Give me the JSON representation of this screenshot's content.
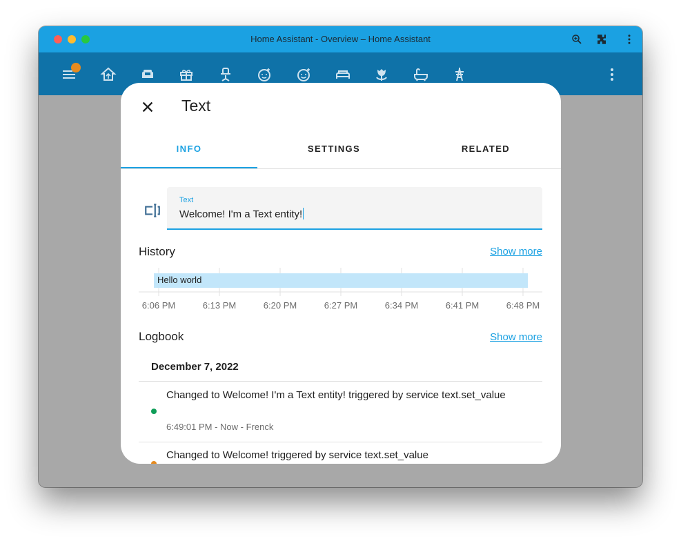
{
  "window": {
    "title": "Home Assistant - Overview – Home Assistant"
  },
  "colors": {
    "accent": "#1ba1e2",
    "toolbar": "#0f72a8",
    "badge": "#e68b1f",
    "dot_green": "#0f9d58",
    "dot_orange": "#e68b1f"
  },
  "toolbar": {
    "icons": [
      "menu-icon",
      "home-icon",
      "sofa-icon",
      "gift-icon",
      "office-chair-icon",
      "baby-face-icon",
      "emoticon-icon",
      "bed-icon",
      "flower-icon",
      "bathtub-icon",
      "tower-icon",
      "more-vertical-icon"
    ]
  },
  "dialog": {
    "title": "Text",
    "tabs": [
      {
        "label": "INFO",
        "active": true
      },
      {
        "label": "SETTINGS",
        "active": false
      },
      {
        "label": "RELATED",
        "active": false
      }
    ],
    "field": {
      "label": "Text",
      "value": "Welcome! I'm a Text entity!"
    },
    "history": {
      "title": "History",
      "show_more": "Show more"
    },
    "logbook": {
      "title": "Logbook",
      "show_more": "Show more",
      "date": "December 7, 2022",
      "entries": [
        {
          "text": "Changed to Welcome! I'm a Text entity! triggered by service text.set_value",
          "meta": "6:49:01 PM - Now - Frenck",
          "color": "#0f9d58"
        },
        {
          "text": "Changed to Welcome! triggered by service text.set_value",
          "meta": "",
          "color": "#e68b1f"
        }
      ]
    }
  },
  "chart_data": {
    "type": "bar",
    "title": "",
    "state": "Hello world",
    "x_ticks": [
      "6:06 PM",
      "6:13 PM",
      "6:20 PM",
      "6:27 PM",
      "6:34 PM",
      "6:41 PM",
      "6:48 PM"
    ],
    "bar_start": "6:06 PM",
    "bar_end": "6:49 PM",
    "grid": true
  }
}
